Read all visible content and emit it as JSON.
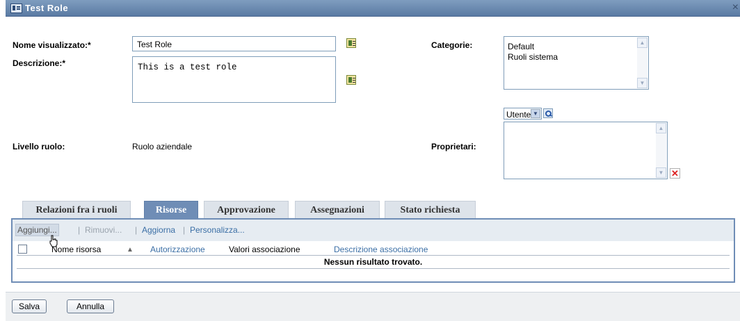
{
  "window": {
    "title": "Test Role",
    "icon": "role-icon",
    "close": "×"
  },
  "form": {
    "display_name_label": "Nome visualizzato:*",
    "display_name_value": "Test Role",
    "description_label": "Descrizione:*",
    "description_value": "This is a test role",
    "level_label": "Livello ruolo:",
    "level_value": "Ruolo aziendale",
    "categories_label": "Categorie:",
    "categories": [
      "Default",
      "Ruoli sistema"
    ],
    "owners_label": "Proprietari:",
    "owners_type": "Utente"
  },
  "tabs": [
    {
      "label": "Relazioni fra i ruoli",
      "active": false
    },
    {
      "label": "Risorse",
      "active": true
    },
    {
      "label": "Approvazione",
      "active": false
    },
    {
      "label": "Assegnazioni",
      "active": false
    },
    {
      "label": "Stato richiesta",
      "active": false
    }
  ],
  "toolbar": {
    "add": "Aggiungi...",
    "remove": "Rimuovi...",
    "refresh": "Aggiorna",
    "customize": "Personalizza...",
    "separator": "|"
  },
  "table": {
    "columns": [
      "Nome risorsa",
      "Autorizzazione",
      "Valori associazione",
      "Descrizione associazione"
    ],
    "sort_indicator": "▲",
    "empty_message": "Nessun risultato trovato."
  },
  "footer": {
    "save": "Salva",
    "cancel": "Annulla"
  },
  "colors": {
    "titlebar": "#5a7aa3",
    "active_tab": "#6f8db6",
    "link": "#3a6ea5"
  }
}
